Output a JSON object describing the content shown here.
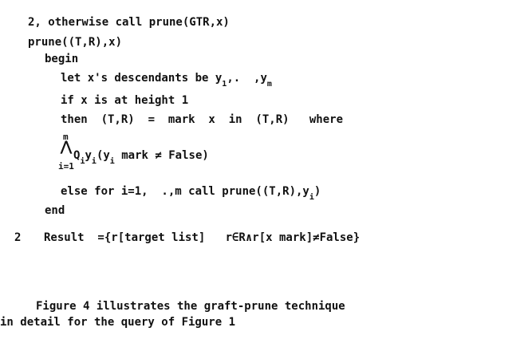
{
  "algorithm": {
    "step2_otherwise": "2, otherwise call prune(GTR,x)",
    "prune_header": "prune((T,R),x)",
    "begin": "begin",
    "descendants": {
      "text": "let x's descendants be y",
      "sub_first": "1",
      "mid": ",.  ,y",
      "sub_last": "m"
    },
    "if_line": "if x is at height 1",
    "then_line": "then  (T,R)  =  mark  x  in  (T,R)   where",
    "conjunction": {
      "upper": "m",
      "operator": "⋀",
      "lower": "i=1",
      "q": "Q",
      "q_sub": "i",
      "y": "y",
      "y_sub": "i",
      "body": "(y",
      "body_sub": "i",
      "tail": " mark ≠ False)"
    },
    "else_line": {
      "text": "else for i=1,  .,m call prune((T,R),y",
      "sub": "i",
      "tail": ")"
    },
    "end": "end"
  },
  "result": {
    "number": "2",
    "text": "Result  ={r[target list]   r∈R∧r[x mark]≠False}"
  },
  "paragraph": {
    "line1": "Figure 4 illustrates the graft-prune technique",
    "line2": "in detail for the query of Figure 1"
  }
}
